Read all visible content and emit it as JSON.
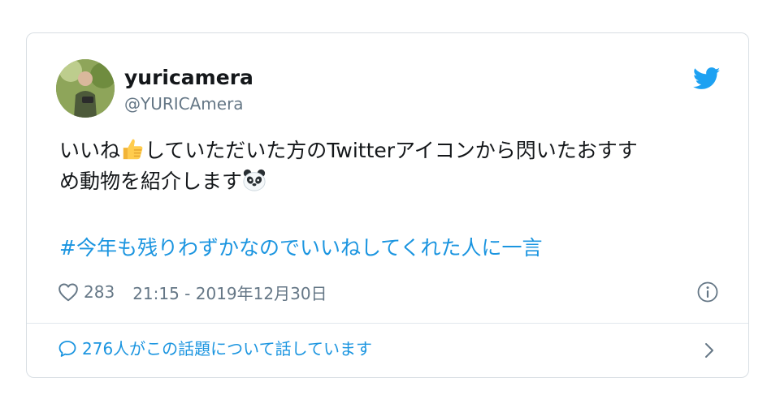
{
  "colors": {
    "accent": "#1b95e0",
    "text": "#14171a",
    "muted": "#657786",
    "border": "#e1e8ed"
  },
  "user": {
    "name": "yuricamera",
    "handle": "@YURICAmera",
    "avatar_icon": "profile-photo"
  },
  "tweet": {
    "text_part1": "いいね",
    "emoji1": "thumbs-up-emoji",
    "text_part2": "していただいた方のTwitterアイコンから閃いたおすす",
    "text_line2": "め動物を紹介します",
    "emoji2": "panda-emoji",
    "hashtag": "#今年も残りわずかなのでいいねしてくれた人に一言"
  },
  "meta": {
    "likes": "283",
    "timestamp": "21:15 - 2019年12月30日"
  },
  "conversation": {
    "label": "276人がこの話題について話しています"
  },
  "icons": [
    "twitter-bird-icon",
    "heart-icon",
    "info-icon",
    "speech-bubble-icon",
    "chevron-right-icon"
  ]
}
